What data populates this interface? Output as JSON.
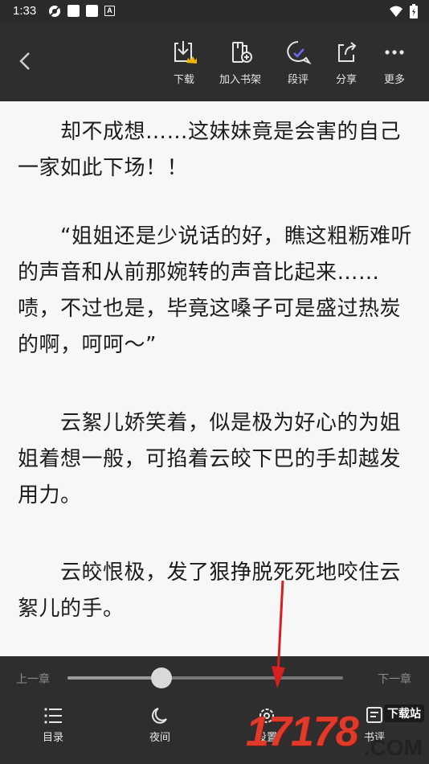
{
  "status_bar": {
    "time": "1:33"
  },
  "toolbar": {
    "download_label": "下载",
    "add_to_shelf_label": "加入书架",
    "comments_label": "段评",
    "share_label": "分享",
    "more_label": "更多"
  },
  "content": {
    "paragraphs": [
      "　　却不成想……这妹妹竟是会害的自己一家如此下场！！",
      "　　“姐姐还是少说话的好，瞧这粗粝难听的声音和从前那婉转的声音比起来……啧，不过也是，毕竟这嗓子可是盛过热炭的啊，呵呵～”",
      "　　云絮儿娇笑着，似是极为好心的为姐姐着想一般，可掐着云皎下巴的手却越发用力。",
      "　　云皎恨极，发了狠挣脱死死地咬住云絮儿的手。"
    ]
  },
  "bottom_panel": {
    "prev_chapter": "上一章",
    "next_chapter": "下一章",
    "progress_fraction": 0.34,
    "tabs": {
      "toc": "目录",
      "night": "夜间",
      "settings": "设置",
      "comments": "书评"
    }
  },
  "watermark": {
    "number": "17178",
    "badge": "下载站",
    "suffix": ".COM"
  },
  "colors": {
    "toolbar": "#2e2e2e",
    "page": "#f7f7f7",
    "text": "#1d1d1d",
    "arrow": "#d81f1f",
    "watermark": "#e03a2a"
  }
}
